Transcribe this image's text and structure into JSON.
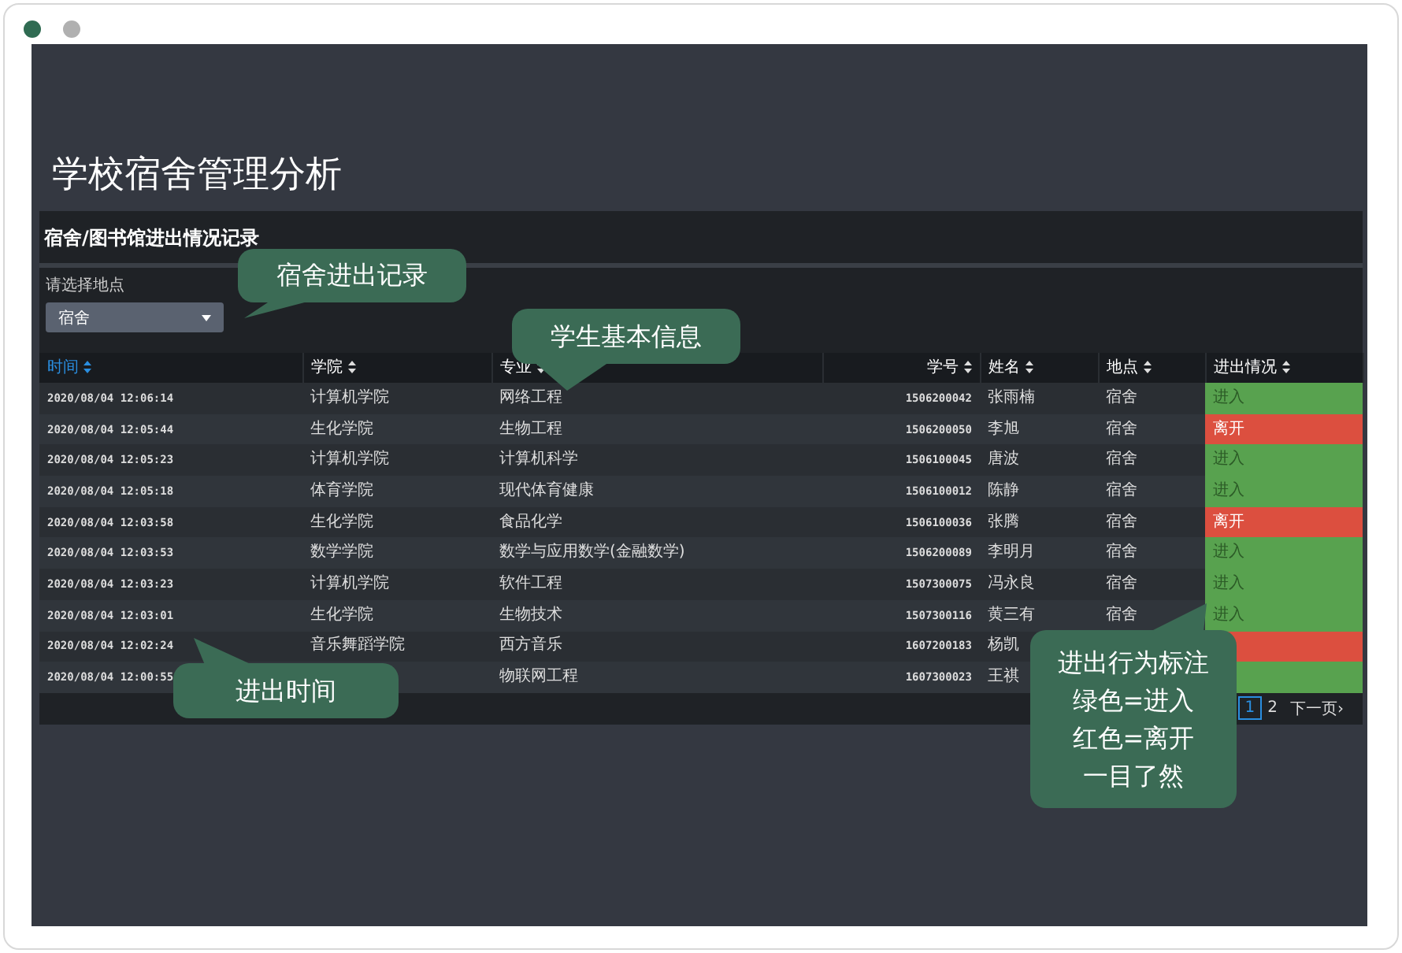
{
  "page_title": "学校宿舍管理分析",
  "panel": {
    "title": "宿舍/图书馆进出情况记录",
    "filter_label": "请选择地点",
    "select_value": "宿舍"
  },
  "table": {
    "columns": [
      {
        "label": "时间",
        "sorted": true
      },
      {
        "label": "学院",
        "sorted": false
      },
      {
        "label": "专业",
        "sorted": false
      },
      {
        "label": "学号",
        "sorted": false
      },
      {
        "label": "姓名",
        "sorted": false
      },
      {
        "label": "地点",
        "sorted": false
      },
      {
        "label": "进出情况",
        "sorted": false
      }
    ],
    "rows": [
      {
        "time": "2020/08/04 12:06:14",
        "college": "计算机学院",
        "major": "网络工程",
        "id": "1506200042",
        "name": "张雨楠",
        "location": "宿舍",
        "status": "进入",
        "kind": "enter"
      },
      {
        "time": "2020/08/04 12:05:44",
        "college": "生化学院",
        "major": "生物工程",
        "id": "1506200050",
        "name": "李旭",
        "location": "宿舍",
        "status": "离开",
        "kind": "leave"
      },
      {
        "time": "2020/08/04 12:05:23",
        "college": "计算机学院",
        "major": "计算机科学",
        "id": "1506100045",
        "name": "唐波",
        "location": "宿舍",
        "status": "进入",
        "kind": "enter"
      },
      {
        "time": "2020/08/04 12:05:18",
        "college": "体育学院",
        "major": "现代体育健康",
        "id": "1506100012",
        "name": "陈静",
        "location": "宿舍",
        "status": "进入",
        "kind": "enter"
      },
      {
        "time": "2020/08/04 12:03:58",
        "college": "生化学院",
        "major": "食品化学",
        "id": "1506100036",
        "name": "张腾",
        "location": "宿舍",
        "status": "离开",
        "kind": "leave"
      },
      {
        "time": "2020/08/04 12:03:53",
        "college": "数学学院",
        "major": "数学与应用数学(金融数学)",
        "id": "1506200089",
        "name": "李明月",
        "location": "宿舍",
        "status": "进入",
        "kind": "enter"
      },
      {
        "time": "2020/08/04 12:03:23",
        "college": "计算机学院",
        "major": "软件工程",
        "id": "1507300075",
        "name": "冯永良",
        "location": "宿舍",
        "status": "进入",
        "kind": "enter"
      },
      {
        "time": "2020/08/04 12:03:01",
        "college": "生化学院",
        "major": "生物技术",
        "id": "1507300116",
        "name": "黄三有",
        "location": "宿舍",
        "status": "进入",
        "kind": "enter"
      },
      {
        "time": "2020/08/04 12:02:24",
        "college": "音乐舞蹈学院",
        "major": "西方音乐",
        "id": "1607200183",
        "name": "杨凯",
        "kind": "leave"
      },
      {
        "time": "2020/08/04 12:00:55",
        "major": "物联网工程",
        "id": "1607300023",
        "name": "王祺",
        "kind": "enter"
      }
    ]
  },
  "pagination": [
    {
      "label": "1",
      "selected": true
    },
    {
      "label": "2",
      "selected": false
    },
    {
      "label": "下一页›",
      "selected": false
    }
  ],
  "callouts": [
    {
      "lines": [
        "宿舍进出记录"
      ],
      "kind": "down-left"
    },
    {
      "lines": [
        "学生基本信息"
      ],
      "kind": "down"
    },
    {
      "lines": [
        "进出时间"
      ],
      "kind": "up"
    },
    {
      "lines": [
        "进出行为标注",
        "绿色=进入",
        "红色=离开",
        "一目了然"
      ],
      "kind": "up-right"
    }
  ]
}
